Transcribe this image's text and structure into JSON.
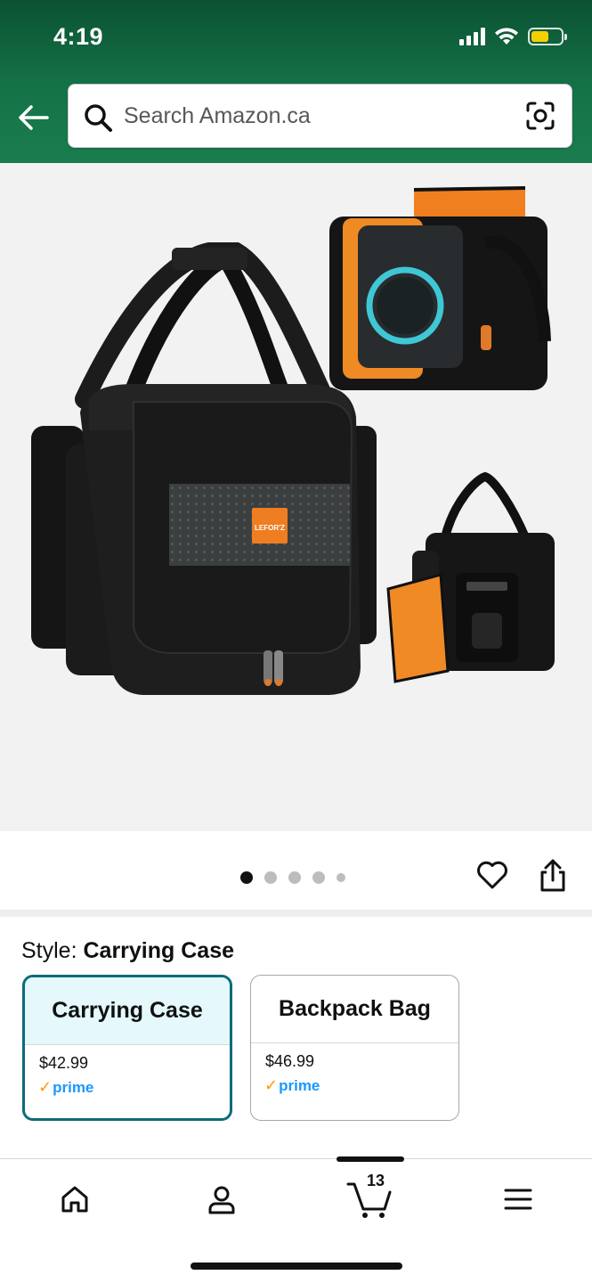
{
  "status_bar": {
    "time": "4:19"
  },
  "search": {
    "placeholder": "Search Amazon.ca"
  },
  "product": {
    "brand_logo_text": "LEFOR'Z",
    "image_count": 5,
    "active_image": 1
  },
  "style_selector": {
    "label_prefix": "Style: ",
    "selected_value": "Carrying Case",
    "options": [
      {
        "name": "Carrying Case",
        "price": "$42.99",
        "prime": "prime",
        "selected": true
      },
      {
        "name": "Backpack Bag",
        "price": "$46.99",
        "prime": "prime",
        "selected": false
      }
    ]
  },
  "bottom_nav": {
    "items": [
      "home-icon",
      "account-icon",
      "cart-icon",
      "menu-icon"
    ],
    "cart_count": "13",
    "active_item": "cart-icon"
  },
  "colors": {
    "header_green": "#157347",
    "selected_card_border": "#0b6b7a",
    "selected_card_bg": "#e5f8fb",
    "prime_blue": "#1a98ff",
    "prime_check": "#ff9900",
    "product_orange": "#f08a24"
  }
}
